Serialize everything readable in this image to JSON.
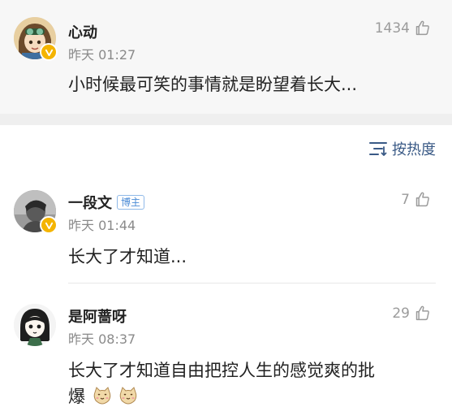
{
  "top_comment": {
    "username": "心动",
    "time": "昨天 01:27",
    "likes": "1434",
    "text": "小时候最可笑的事情就是盼望着长大..."
  },
  "sort": {
    "label": "按热度"
  },
  "comments": [
    {
      "username": "一段文",
      "tag": "博主",
      "time": "昨天 01:44",
      "likes": "7",
      "text": "长大了才知道..."
    },
    {
      "username": "是阿蔷呀",
      "time": "昨天 08:37",
      "likes": "29",
      "text_line1": "长大了才知道自由把控人生的感觉爽的批",
      "text_line2": "爆"
    }
  ],
  "colors": {
    "verified_badge": "#f4b400",
    "link_blue": "#3a5a86",
    "tag_blue": "#4a8bd6"
  },
  "icons": [
    "thumbs-up-icon",
    "verified-badge-icon",
    "sort-icon",
    "cat-emoji-icon"
  ]
}
